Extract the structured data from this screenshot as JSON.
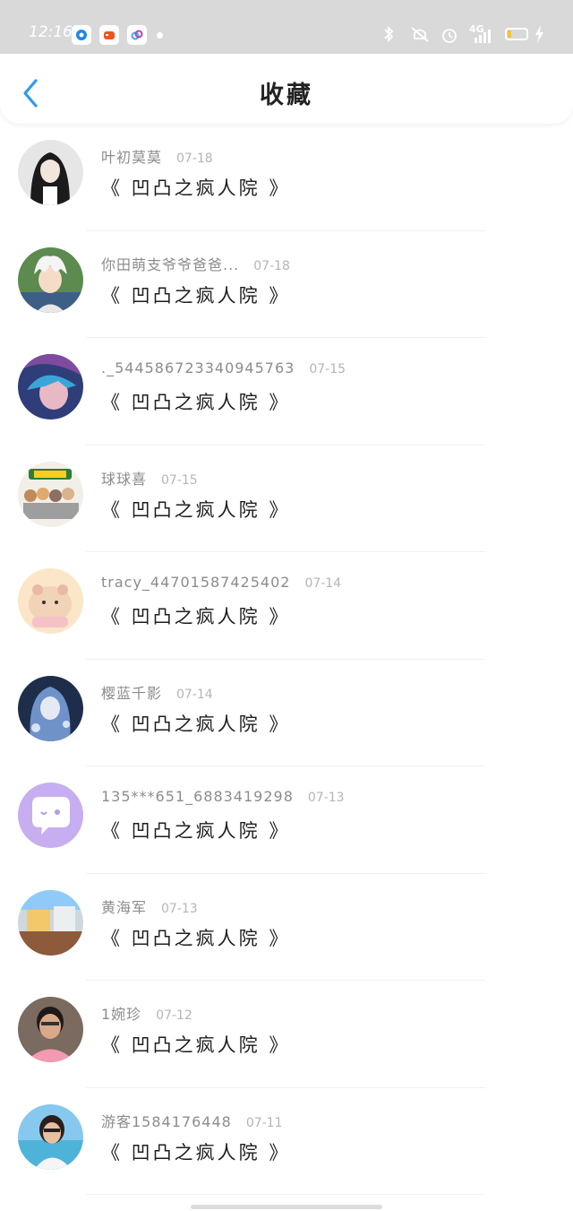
{
  "status_bar": {
    "time": "12:16",
    "network": "4G"
  },
  "header": {
    "title": "收藏"
  },
  "items": [
    {
      "author": "叶初莫莫",
      "date": "07-18",
      "title": "《 凹凸之疯人院 》",
      "avatar": "anime-girl-avatar"
    },
    {
      "author": "你田萌支爷爷爸爸...",
      "date": "07-18",
      "title": "《 凹凸之疯人院 》",
      "avatar": "white-hair-boy-avatar"
    },
    {
      "author": "._5445867233409457​63",
      "date": "07-15",
      "title": "《 凹凸之疯人院 》",
      "avatar": "blue-hair-avatar"
    },
    {
      "author": "球球喜",
      "date": "07-15",
      "title": "《 凹凸之疯人院 》",
      "avatar": "game-group-avatar"
    },
    {
      "author": "tracy_44701587425402",
      "date": "07-14",
      "title": "《 凹凸之疯人院 》",
      "avatar": "hamster-avatar"
    },
    {
      "author": "樱蓝千影",
      "date": "07-14",
      "title": "《 凹凸之疯人院 》",
      "avatar": "blue-doll-avatar"
    },
    {
      "author": "135***651_6883419298",
      "date": "07-13",
      "title": "《 凹凸之疯人院 》",
      "avatar": "default-chat-avatar"
    },
    {
      "author": "黄海军",
      "date": "07-13",
      "title": "《 凹凸之疯人院 》",
      "avatar": "room-photo-avatar"
    },
    {
      "author": "1婉珍",
      "date": "07-12",
      "title": "《 凹凸之疯人院 》",
      "avatar": "woman-photo-avatar"
    },
    {
      "author": "游客1584176448",
      "date": "07-11",
      "title": "《 凹凸之疯人院 》",
      "avatar": "beach-photo-avatar"
    }
  ],
  "colors": {
    "accent": "#2d9bf0",
    "status_bar": "#d9d9d9",
    "author_text": "#8c8c8c",
    "title_text": "#1e1e1e"
  }
}
